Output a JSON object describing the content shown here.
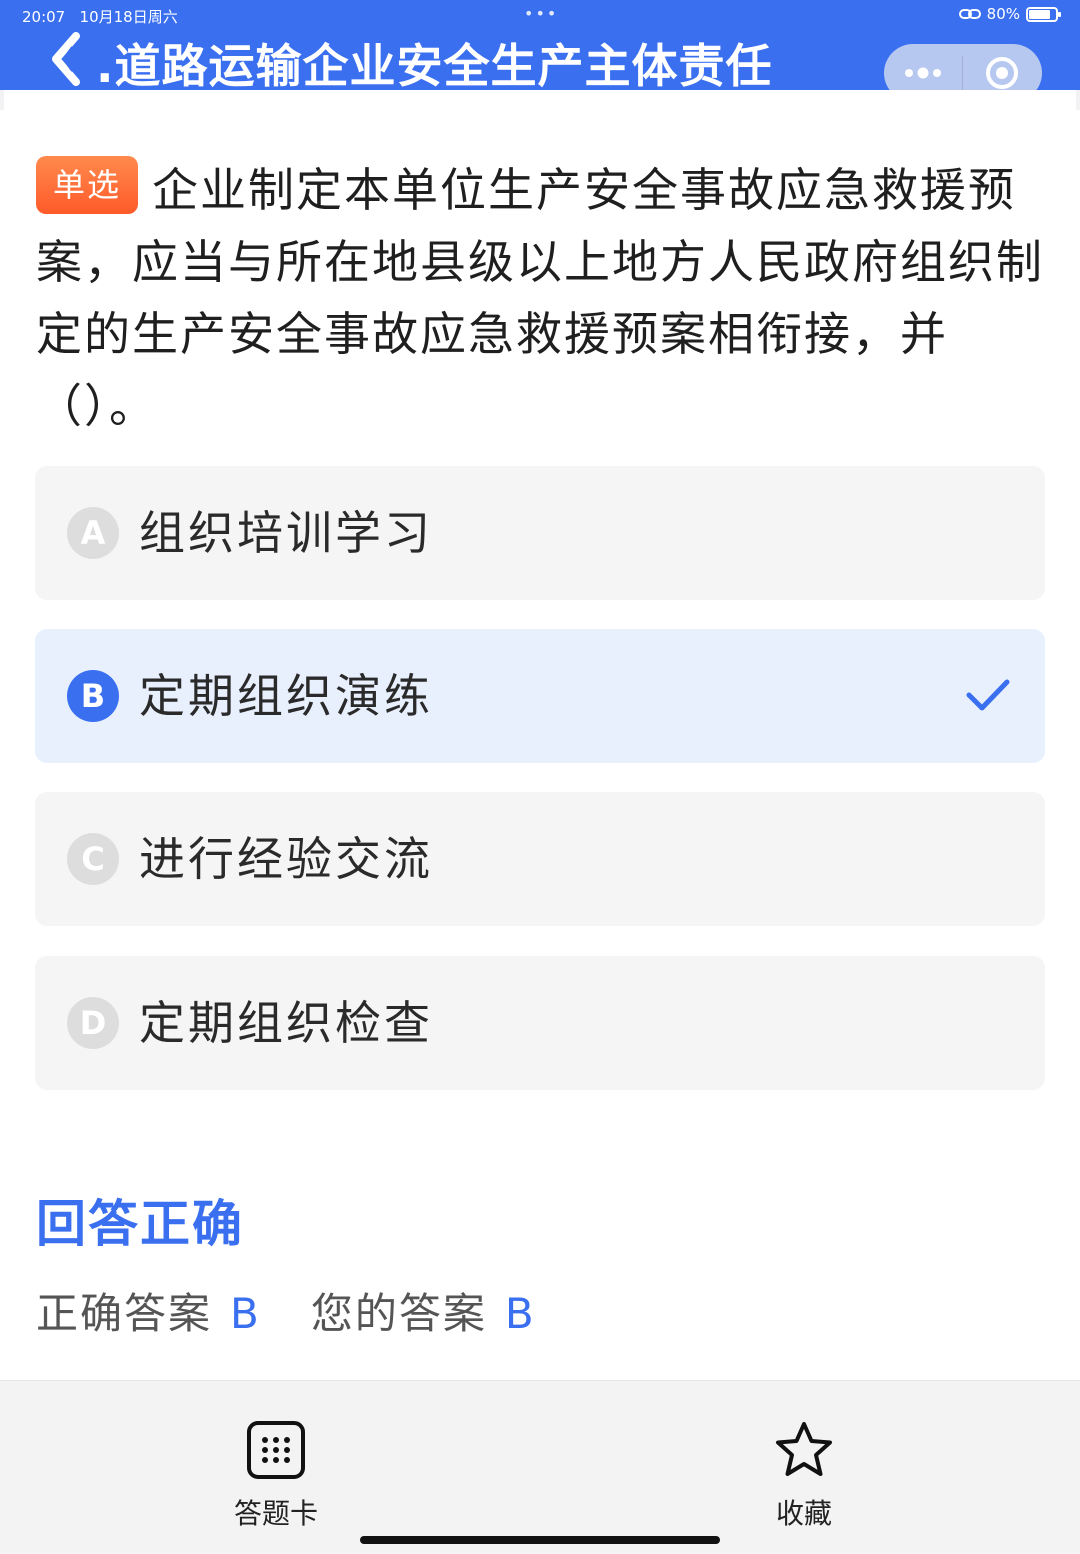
{
  "status_bar": {
    "time": "20:07",
    "date": "10月18日周六",
    "dots": "•••",
    "battery": "80%",
    "battery_level": 0.8
  },
  "header": {
    "title": ".道路运输企业安全生产主体责任",
    "background": "#3a6ff0"
  },
  "question": {
    "type_badge": "单选",
    "text": "企业制定本单位生产安全事故应急救援预案，应当与所在地县级以上地方人民政府组织制定的生产安全事故应急救援预案相衔接，并（）。"
  },
  "options": [
    {
      "letter": "A",
      "text": "组织培训学习",
      "selected": false
    },
    {
      "letter": "B",
      "text": "定期组织演练",
      "selected": true
    },
    {
      "letter": "C",
      "text": "进行经验交流",
      "selected": false
    },
    {
      "letter": "D",
      "text": "定期组织检查",
      "selected": false
    }
  ],
  "result": {
    "title": "回答正确",
    "correct_label": "正确答案",
    "correct_value": "B",
    "your_label": "您的答案",
    "your_value": "B"
  },
  "bottom_nav": {
    "answer_card": "答题卡",
    "favorite": "收藏"
  },
  "colors": {
    "accent": "#3a6ff0",
    "badge": "#ff6a33",
    "selected_bg": "#e8effd"
  }
}
